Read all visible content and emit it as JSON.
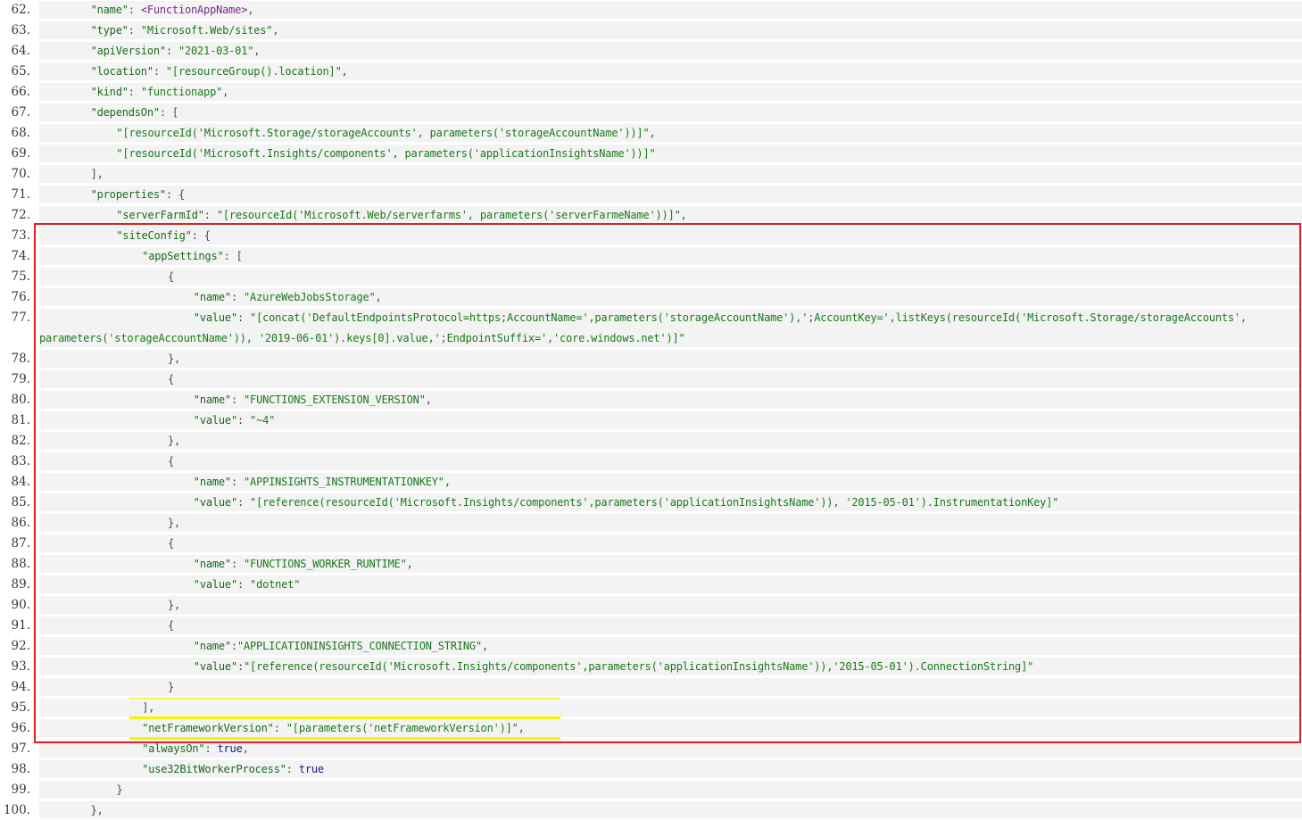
{
  "lines": [
    {
      "n": "62.",
      "ind": 8,
      "tokens": [
        [
          "k",
          "\"name\""
        ],
        [
          "p",
          ": "
        ],
        [
          "sp",
          "<FunctionAppName>"
        ],
        [
          "p",
          ","
        ]
      ]
    },
    {
      "n": "63.",
      "ind": 8,
      "tokens": [
        [
          "k",
          "\"type\""
        ],
        [
          "p",
          ": "
        ],
        [
          "s",
          "\"Microsoft.Web/sites\""
        ],
        [
          "p",
          ","
        ]
      ]
    },
    {
      "n": "64.",
      "ind": 8,
      "tokens": [
        [
          "k",
          "\"apiVersion\""
        ],
        [
          "p",
          ": "
        ],
        [
          "s",
          "\"2021-03-01\""
        ],
        [
          "p",
          ","
        ]
      ]
    },
    {
      "n": "65.",
      "ind": 8,
      "tokens": [
        [
          "k",
          "\"location\""
        ],
        [
          "p",
          ": "
        ],
        [
          "s",
          "\"[resourceGroup().location]\""
        ],
        [
          "p",
          ","
        ]
      ]
    },
    {
      "n": "66.",
      "ind": 8,
      "tokens": [
        [
          "k",
          "\"kind\""
        ],
        [
          "p",
          ": "
        ],
        [
          "s",
          "\"functionapp\""
        ],
        [
          "p",
          ","
        ]
      ]
    },
    {
      "n": "67.",
      "ind": 8,
      "tokens": [
        [
          "k",
          "\"dependsOn\""
        ],
        [
          "p",
          ": ["
        ]
      ]
    },
    {
      "n": "68.",
      "ind": 12,
      "tokens": [
        [
          "s",
          "\"[resourceId('Microsoft.Storage/storageAccounts', parameters('storageAccountName'))]\""
        ],
        [
          "p",
          ","
        ]
      ]
    },
    {
      "n": "69.",
      "ind": 12,
      "tokens": [
        [
          "s",
          "\"[resourceId('Microsoft.Insights/components', parameters('applicationInsightsName'))]\""
        ]
      ]
    },
    {
      "n": "70.",
      "ind": 8,
      "tokens": [
        [
          "p",
          "],"
        ]
      ]
    },
    {
      "n": "71.",
      "ind": 8,
      "tokens": [
        [
          "k",
          "\"properties\""
        ],
        [
          "p",
          ": {"
        ]
      ]
    },
    {
      "n": "72.",
      "ind": 12,
      "tokens": [
        [
          "k",
          "\"serverFarmId\""
        ],
        [
          "p",
          ": "
        ],
        [
          "s",
          "\"[resourceId('Microsoft.Web/serverfarms', parameters('serverFarmeName'))]\""
        ],
        [
          "p",
          ","
        ]
      ]
    },
    {
      "n": "73.",
      "ind": 12,
      "tokens": [
        [
          "k",
          "\"siteConfig\""
        ],
        [
          "p",
          ": {"
        ]
      ]
    },
    {
      "n": "74.",
      "ind": 16,
      "tokens": [
        [
          "k",
          "\"appSettings\""
        ],
        [
          "p",
          ": ["
        ]
      ]
    },
    {
      "n": "75.",
      "ind": 20,
      "tokens": [
        [
          "p",
          "{"
        ]
      ]
    },
    {
      "n": "76.",
      "ind": 24,
      "tokens": [
        [
          "k",
          "\"name\""
        ],
        [
          "p",
          ": "
        ],
        [
          "s",
          "\"AzureWebJobsStorage\""
        ],
        [
          "p",
          ","
        ]
      ]
    },
    {
      "n": "77.",
      "ind": 24,
      "wrap": true,
      "tokens": [
        [
          "k",
          "\"value\""
        ],
        [
          "p",
          ": "
        ],
        [
          "s",
          "\"[concat('DefaultEndpointsProtocol=https;AccountName=',parameters('storageAccountName'),';AccountKey=',listKeys(resourceId('Microsoft.Storage/storageAccounts', "
        ]
      ],
      "tokens2": [
        [
          "s",
          "parameters('storageAccountName')), '2019-06-01').keys[0].value,';EndpointSuffix=','core.windows.net')]\""
        ]
      ]
    },
    {
      "n": "78.",
      "ind": 20,
      "tokens": [
        [
          "p",
          "},"
        ]
      ]
    },
    {
      "n": "79.",
      "ind": 20,
      "tokens": [
        [
          "p",
          "{"
        ]
      ]
    },
    {
      "n": "80.",
      "ind": 24,
      "tokens": [
        [
          "k",
          "\"name\""
        ],
        [
          "p",
          ": "
        ],
        [
          "s",
          "\"FUNCTIONS_EXTENSION_VERSION\""
        ],
        [
          "p",
          ","
        ]
      ]
    },
    {
      "n": "81.",
      "ind": 24,
      "tokens": [
        [
          "k",
          "\"value\""
        ],
        [
          "p",
          ": "
        ],
        [
          "s",
          "\"~4\""
        ]
      ]
    },
    {
      "n": "82.",
      "ind": 20,
      "tokens": [
        [
          "p",
          "},"
        ]
      ]
    },
    {
      "n": "83.",
      "ind": 20,
      "tokens": [
        [
          "p",
          "{"
        ]
      ]
    },
    {
      "n": "84.",
      "ind": 24,
      "tokens": [
        [
          "k",
          "\"name\""
        ],
        [
          "p",
          ": "
        ],
        [
          "s",
          "\"APPINSIGHTS_INSTRUMENTATIONKEY\""
        ],
        [
          "p",
          ","
        ]
      ]
    },
    {
      "n": "85.",
      "ind": 24,
      "tokens": [
        [
          "k",
          "\"value\""
        ],
        [
          "p",
          ": "
        ],
        [
          "s",
          "\"[reference(resourceId('Microsoft.Insights/components',parameters('applicationInsightsName')), '2015-05-01').InstrumentationKey]\""
        ]
      ]
    },
    {
      "n": "86.",
      "ind": 20,
      "tokens": [
        [
          "p",
          "},"
        ]
      ]
    },
    {
      "n": "87.",
      "ind": 20,
      "tokens": [
        [
          "p",
          "{"
        ]
      ]
    },
    {
      "n": "88.",
      "ind": 24,
      "tokens": [
        [
          "k",
          "\"name\""
        ],
        [
          "p",
          ": "
        ],
        [
          "s",
          "\"FUNCTIONS_WORKER_RUNTIME\""
        ],
        [
          "p",
          ","
        ]
      ]
    },
    {
      "n": "89.",
      "ind": 24,
      "tokens": [
        [
          "k",
          "\"value\""
        ],
        [
          "p",
          ": "
        ],
        [
          "s",
          "\"dotnet\""
        ]
      ]
    },
    {
      "n": "90.",
      "ind": 20,
      "tokens": [
        [
          "p",
          "},"
        ]
      ]
    },
    {
      "n": "91.",
      "ind": 20,
      "tokens": [
        [
          "p",
          "{"
        ]
      ]
    },
    {
      "n": "92.",
      "ind": 24,
      "tokens": [
        [
          "k",
          "\"name\""
        ],
        [
          "p",
          ":"
        ],
        [
          "s",
          "\"APPLICATIONINSIGHTS_CONNECTION_STRING\""
        ],
        [
          "p",
          ","
        ]
      ]
    },
    {
      "n": "93.",
      "ind": 24,
      "tokens": [
        [
          "k",
          "\"value\""
        ],
        [
          "p",
          ":"
        ],
        [
          "s",
          "\"[reference(resourceId('Microsoft.Insights/components',parameters('applicationInsightsName')),'2015-05-01').ConnectionString]\""
        ]
      ]
    },
    {
      "n": "94.",
      "ind": 20,
      "tokens": [
        [
          "p",
          "}"
        ]
      ]
    },
    {
      "n": "95.",
      "ind": 16,
      "tokens": [
        [
          "p",
          "],"
        ]
      ]
    },
    {
      "n": "96.",
      "ind": 16,
      "tokens": [
        [
          "k",
          "\"netFrameworkVersion\""
        ],
        [
          "p",
          ": "
        ],
        [
          "s",
          "\"[parameters('netFrameworkVersion')]\""
        ],
        [
          "p",
          ","
        ]
      ]
    },
    {
      "n": "97.",
      "ind": 16,
      "tokens": [
        [
          "k",
          "\"alwaysOn\""
        ],
        [
          "p",
          ": "
        ],
        [
          "kw",
          "true"
        ],
        [
          "p",
          ","
        ]
      ]
    },
    {
      "n": "98.",
      "ind": 16,
      "tokens": [
        [
          "k",
          "\"use32BitWorkerProcess\""
        ],
        [
          "p",
          ": "
        ],
        [
          "kw",
          "true"
        ]
      ]
    },
    {
      "n": "99.",
      "ind": 12,
      "tokens": [
        [
          "p",
          "}"
        ]
      ]
    },
    {
      "n": "100.",
      "ind": 8,
      "tokens": [
        [
          "p",
          "},"
        ]
      ]
    }
  ],
  "highlight_red": {
    "from_line": "73.",
    "to_line": "96."
  },
  "highlight_yellow": {
    "lines": [
      "95.",
      "96."
    ]
  },
  "colors": {
    "key": "#1a6a1a",
    "string": "#1a7a1a",
    "placeholder": "#7a2a8a",
    "keyword": "#1a1a8a",
    "line_bg": "#f3f3f3",
    "red_box": "#e02020",
    "yellow_box": "#f5f500"
  }
}
